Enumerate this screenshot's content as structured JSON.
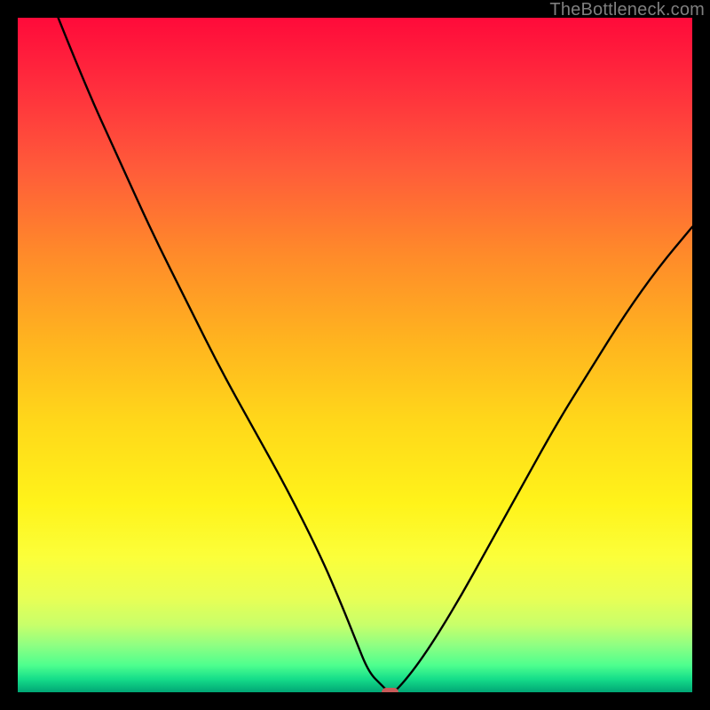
{
  "watermark": "TheBottleneck.com",
  "colors": {
    "marker": "#c95a59",
    "curve": "#000000",
    "background": "#000000"
  },
  "chart_data": {
    "type": "line",
    "title": "",
    "xlabel": "",
    "ylabel": "",
    "xlim": [
      0,
      100
    ],
    "ylim": [
      0,
      100
    ],
    "grid": false,
    "legend": false,
    "series": [
      {
        "name": "bottleneck-curve",
        "x": [
          6,
          10,
          15,
          20,
          25,
          30,
          35,
          40,
          45,
          48,
          50,
          52,
          54,
          55,
          56,
          60,
          65,
          70,
          75,
          80,
          85,
          90,
          95,
          100
        ],
        "y": [
          100,
          90,
          79,
          68,
          58,
          48,
          39,
          30,
          20,
          13,
          8,
          3,
          1,
          0,
          0,
          5,
          13,
          22,
          31,
          40,
          48,
          56,
          63,
          69
        ]
      }
    ],
    "marker": {
      "x": 55.2,
      "y": 0,
      "w": 2.4,
      "h": 1.4
    },
    "gradient_stops": [
      {
        "pct": 0,
        "color": "#ff0a3a"
      },
      {
        "pct": 10,
        "color": "#ff2d3d"
      },
      {
        "pct": 22,
        "color": "#ff5a3a"
      },
      {
        "pct": 35,
        "color": "#ff8a2a"
      },
      {
        "pct": 48,
        "color": "#ffb41f"
      },
      {
        "pct": 60,
        "color": "#ffd81a"
      },
      {
        "pct": 72,
        "color": "#fff31a"
      },
      {
        "pct": 80,
        "color": "#fbff3a"
      },
      {
        "pct": 86,
        "color": "#e8ff55"
      },
      {
        "pct": 90,
        "color": "#c8ff6a"
      },
      {
        "pct": 93,
        "color": "#8fff82"
      },
      {
        "pct": 96,
        "color": "#4eff8e"
      },
      {
        "pct": 98,
        "color": "#16de8a"
      },
      {
        "pct": 100,
        "color": "#00a675"
      }
    ]
  }
}
